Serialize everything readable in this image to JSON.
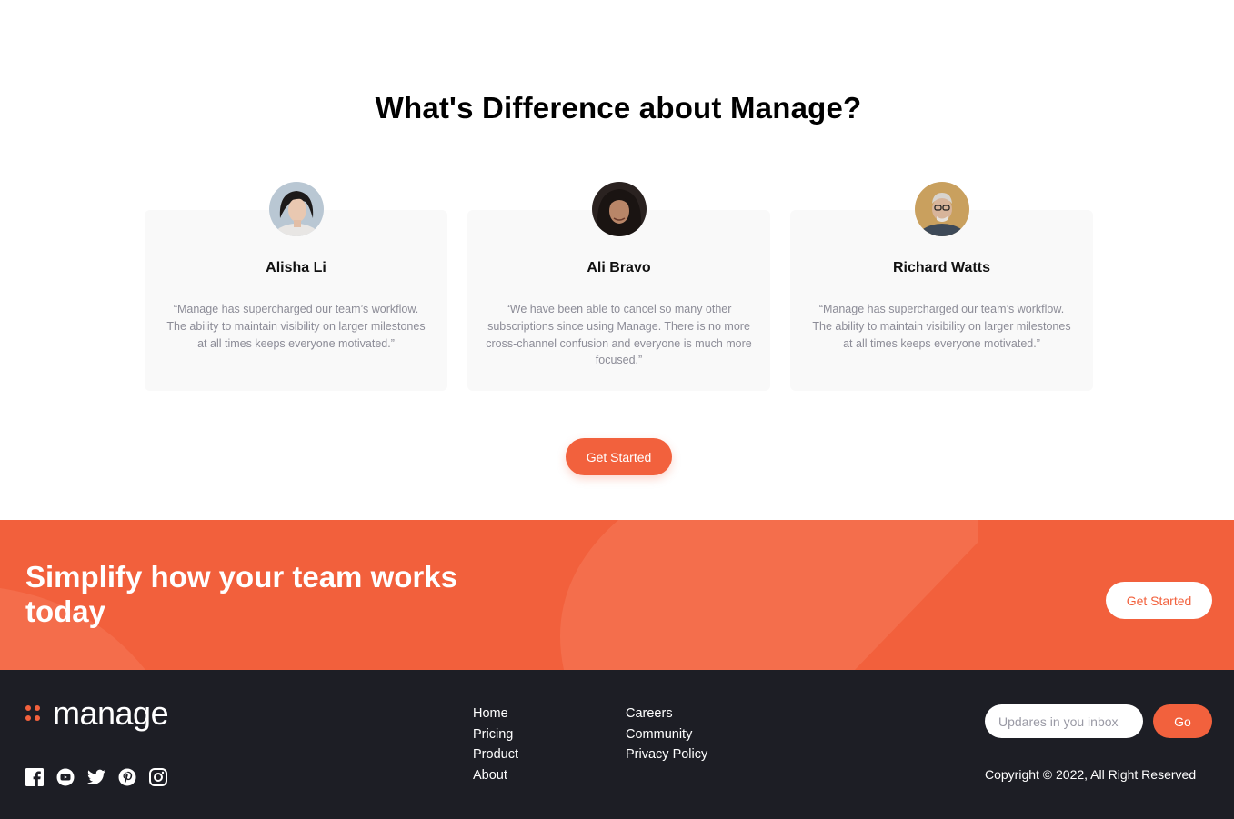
{
  "testimonials": {
    "title": "What's Difference about Manage?",
    "items": [
      {
        "name": "Alisha Li",
        "quote": "“Manage has supercharged our team’s workflow. The ability to maintain visibility on larger milestones at all times keeps everyone motivated.”"
      },
      {
        "name": "Ali Bravo",
        "quote": "“We have been able to cancel so many other subscriptions since using Manage. There is no more cross-channel confusion and everyone is much more focused.”"
      },
      {
        "name": "Richard Watts",
        "quote": "“Manage has supercharged our team’s workflow. The ability to maintain visibility on larger milestones at all times keeps everyone motivated.”"
      }
    ],
    "cta_label": "Get Started"
  },
  "cta": {
    "title": "Simplify how your team works today",
    "button_label": "Get Started"
  },
  "footer": {
    "logo_text": "manage",
    "social_icons": [
      "facebook-icon",
      "youtube-icon",
      "twitter-icon",
      "pinterest-icon",
      "instagram-icon"
    ],
    "links_col1": [
      "Home",
      "Pricing",
      "Product",
      "About"
    ],
    "links_col2": [
      "Careers",
      "Community",
      "Privacy Policy"
    ],
    "newsletter_placeholder": "Updares in you inbox",
    "go_label": "Go",
    "copyright": "Copyright © 2022, All Right Reserved"
  },
  "colors": {
    "accent": "#f2613d",
    "footer_bg": "#1d1e25",
    "card_bg": "#f9f9f9"
  }
}
